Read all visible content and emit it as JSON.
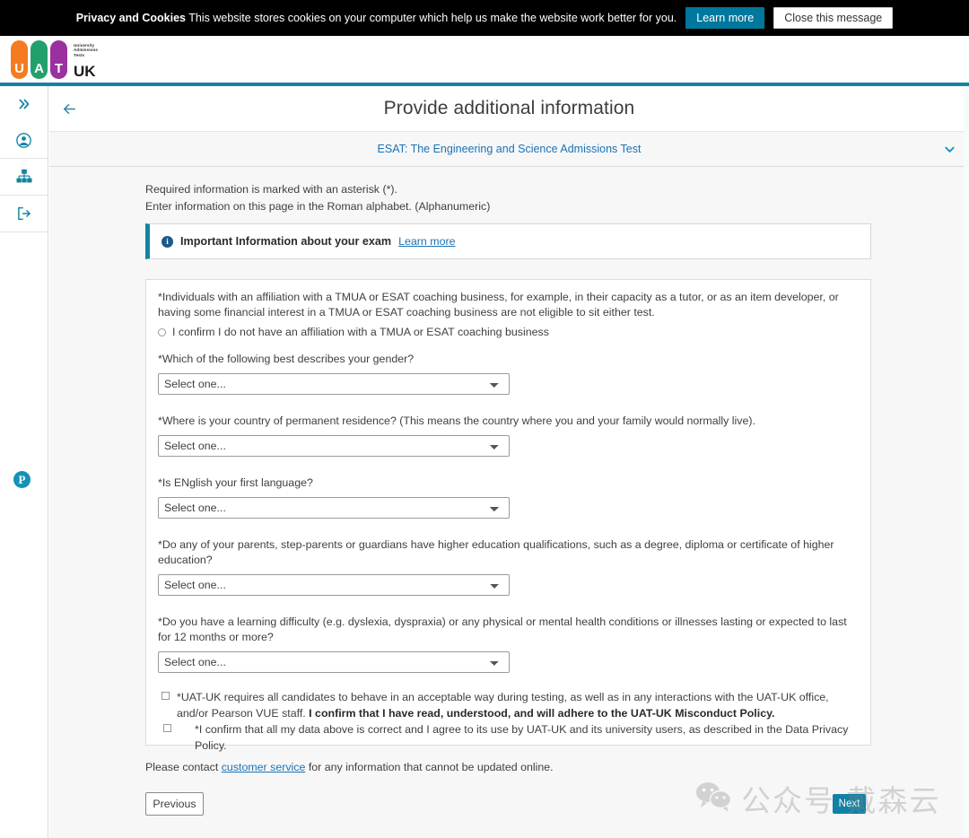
{
  "cookie_banner": {
    "title": "Privacy and Cookies",
    "message": " This website stores cookies on your computer which help us make the website work better for you.",
    "learn_more_label": "Learn more",
    "close_label": "Close this message",
    "accent_color": "#00789e"
  },
  "logo": {
    "letters": [
      "U",
      "A",
      "T"
    ],
    "tagline_line1": "University",
    "tagline_line2": "Admissions",
    "tagline_line3": "Tests",
    "suffix": "UK",
    "colors": {
      "u": "#f47b20",
      "a": "#22a06b",
      "t": "#9b30a0",
      "rule": "#1483a0"
    }
  },
  "sidebar": {
    "items": [
      {
        "name": "expand-menu",
        "icon": "chevron-double-right-icon"
      },
      {
        "name": "account",
        "icon": "user-circle-icon"
      },
      {
        "name": "organisation",
        "icon": "sitemap-icon"
      },
      {
        "name": "sign-out",
        "icon": "logout-icon"
      }
    ],
    "brand_mark": "P"
  },
  "header": {
    "back_icon": "arrow-left-icon",
    "title": "Provide additional information"
  },
  "exam_strip": {
    "label": "ESAT: The Engineering and Science Admissions Test",
    "chevron_icon": "chevron-down-icon",
    "link_color": "#1b73b5"
  },
  "intro": {
    "line1": "Required information is marked with an asterisk (*).",
    "line2": "Enter information on this page in the Roman alphabet. (Alphanumeric)"
  },
  "info_box": {
    "icon": "info-circle-icon",
    "title": "Important Information about your exam",
    "link_label": "Learn more",
    "accent_color": "#1483a0"
  },
  "form": {
    "affiliation": {
      "statement": "*Individuals with an affiliation with a TMUA or ESAT coaching business, for example, in their capacity as a tutor, or as an item developer, or having some financial interest in a TMUA or ESAT coaching business are not eligible to sit either test.",
      "radio_label": "I confirm I do not have an affiliation with a TMUA or ESAT coaching business"
    },
    "questions": [
      {
        "label": "*Which of the following best describes your gender?",
        "value": "Select one...",
        "placeholder": "Select one..."
      },
      {
        "label": "*Where is your country of permanent residence? (This means the country where you and your family would normally live).",
        "value": "Select one...",
        "placeholder": "Select one..."
      },
      {
        "label": "*Is ENglish your first language?",
        "value": "Select one...",
        "placeholder": "Select one..."
      },
      {
        "label": "*Do any of your parents, step-parents or guardians have higher education qualifications, such as a degree, diploma or certificate of higher education?",
        "value": "Select one...",
        "placeholder": "Select one..."
      },
      {
        "label": "*Do you have a learning difficulty (e.g. dyslexia, dyspraxia) or any physical or mental health conditions or illnesses lasting or expected to last for 12 months or more?",
        "value": "Select one...",
        "placeholder": "Select one..."
      }
    ],
    "checkbox_misconduct_plain": "*UAT-UK requires all candidates to behave in an acceptable way during testing, as well as in any interactions with the UAT-UK office, and/or Pearson VUE staff. ",
    "checkbox_misconduct_bold": "I confirm that I have read, understood, and will adhere to the UAT-UK Misconduct Policy.",
    "checkbox_data_privacy": "*I confirm that all my data above is correct and I agree to its use by UAT-UK and its university users, as described in the Data Privacy Policy."
  },
  "footer": {
    "note_before": "Please contact ",
    "note_link": "customer service",
    "note_after": " for any information that cannot be updated online.",
    "previous_label": "Previous",
    "next_label": "Next"
  },
  "watermark": {
    "icon": "wechat-icon",
    "text": "公众号 戴森云"
  }
}
